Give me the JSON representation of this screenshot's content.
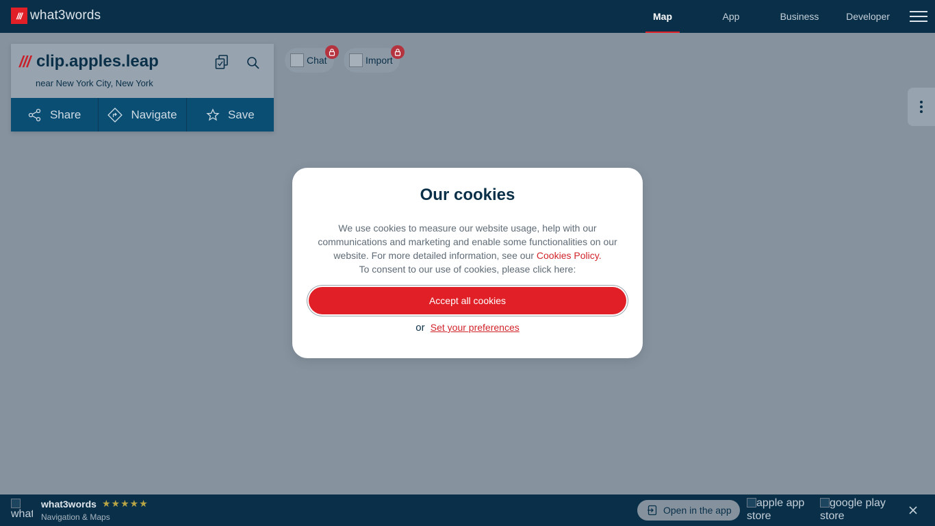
{
  "header": {
    "brand": "what3words",
    "logo_mark": "///",
    "nav": [
      {
        "label": "Map",
        "active": true
      },
      {
        "label": "App",
        "active": false
      },
      {
        "label": "Business",
        "active": false
      },
      {
        "label": "Developer",
        "active": false
      }
    ],
    "menu_icon": "hamburger-icon"
  },
  "address_card": {
    "slashes": "///",
    "words": "clip.apples.leap",
    "near": "near New York City, New York",
    "icons": [
      "copy-icon",
      "search-icon"
    ],
    "actions": [
      {
        "label": "Share",
        "icon": "share-icon"
      },
      {
        "label": "Navigate",
        "icon": "navigate-icon"
      },
      {
        "label": "Save",
        "icon": "star-icon"
      }
    ]
  },
  "locked_features": [
    {
      "label": "Chat",
      "icon": "lock-icon"
    },
    {
      "label": "Import",
      "icon": "lock-icon"
    }
  ],
  "cookie_modal": {
    "title": "Our cookies",
    "body_1": "We use cookies to measure our website usage, help with our communications and marketing and enable some functionalities on our website. For more detailed information, see our ",
    "policy_link": "Cookies Policy",
    "body_2": ".",
    "body_3": "To consent to our use of cookies, please click here:",
    "accept_label": "Accept all cookies",
    "or_text": "or",
    "preferences_label": "Set your preferences"
  },
  "app_banner": {
    "logo_alt": "what",
    "app_name": "what3words",
    "stars": "★★★★★",
    "rating": 5,
    "subtitle": "Navigation & Maps",
    "open_label": "Open in the app",
    "apple_alt": "apple app store",
    "google_alt": "google play store"
  },
  "colors": {
    "navy": "#0a3049",
    "accent_red": "#e11f26",
    "action_blue": "#0b4e73",
    "overlay": "#86939f"
  }
}
